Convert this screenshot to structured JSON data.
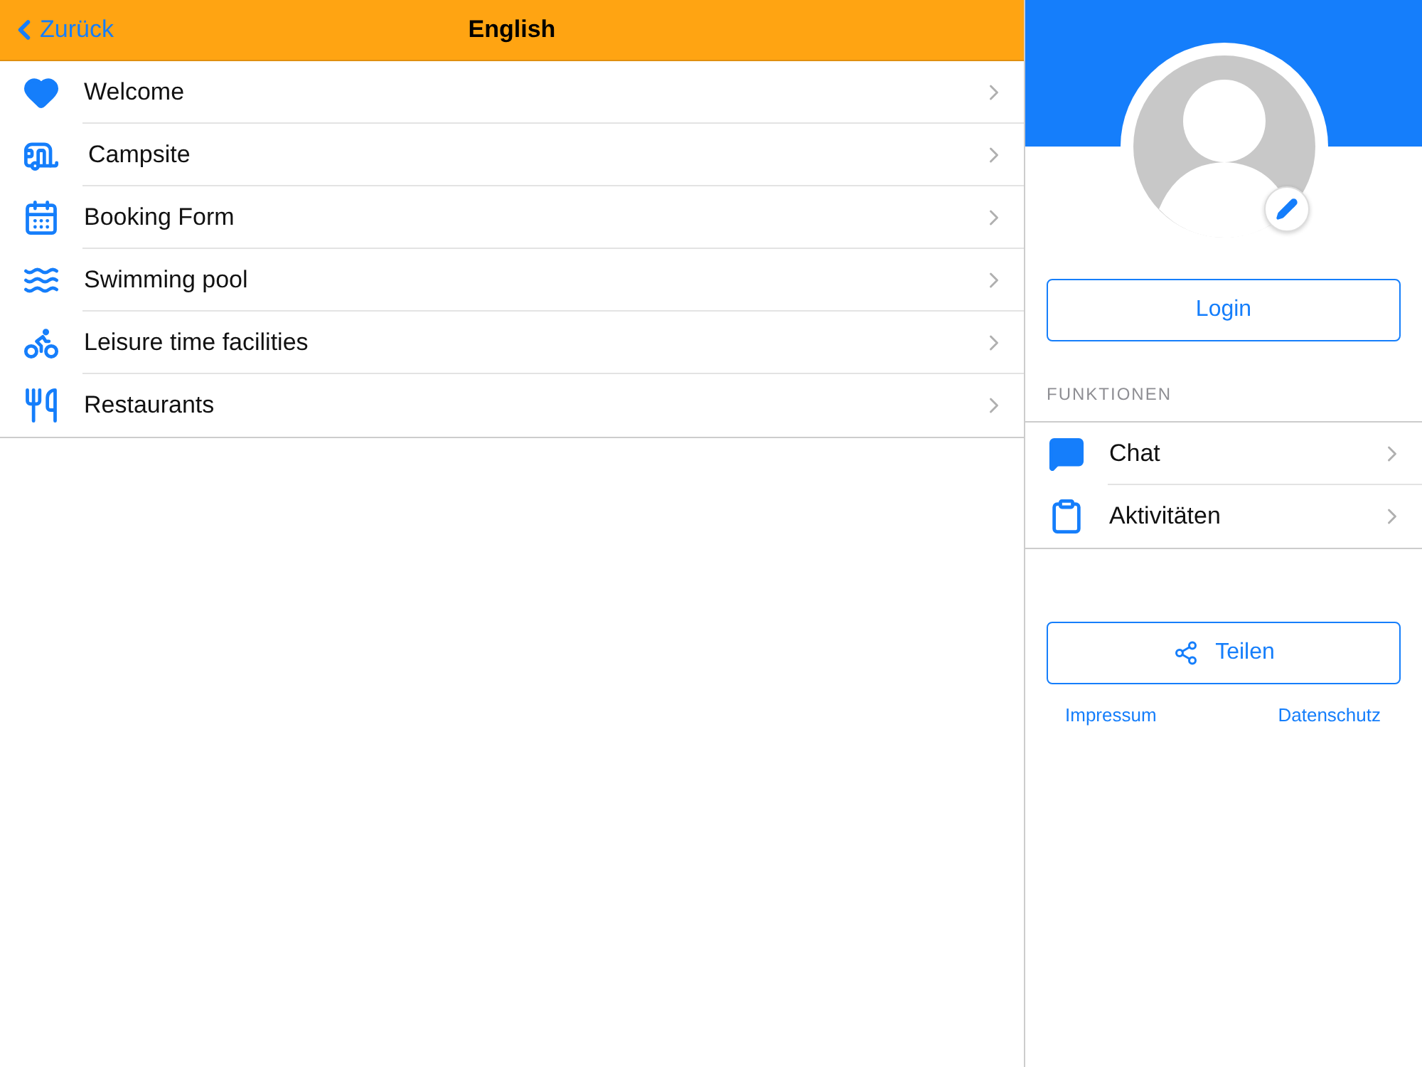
{
  "header": {
    "back": "Zurück",
    "title": "English"
  },
  "menu": [
    {
      "label": "Welcome"
    },
    {
      "label": "Campsite"
    },
    {
      "label": "Booking Form"
    },
    {
      "label": "Swimming pool"
    },
    {
      "label": "Leisure time facilities"
    },
    {
      "label": "Restaurants"
    }
  ],
  "profile": {
    "login": "Login",
    "section": "FUNKTIONEN",
    "functions": [
      {
        "label": "Chat"
      },
      {
        "label": "Aktivitäten"
      }
    ],
    "share": "Teilen",
    "links": [
      "Impressum",
      "Datenschutz"
    ]
  }
}
